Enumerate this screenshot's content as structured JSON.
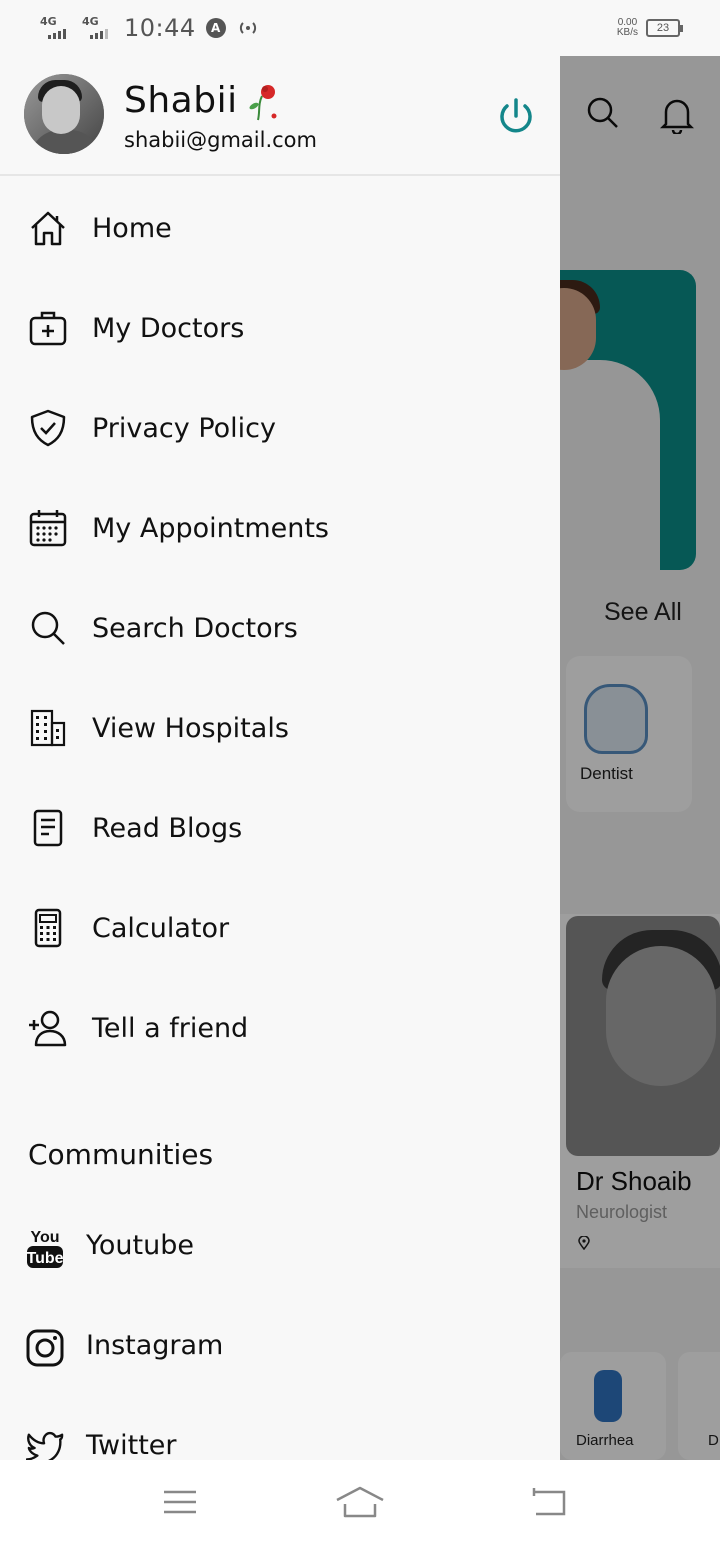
{
  "status_bar": {
    "network1": "4G",
    "network2": "4G",
    "time": "10:44",
    "app_icon": "A",
    "speed_value": "0.00",
    "speed_unit": "KB/s",
    "battery": "23"
  },
  "drawer": {
    "user_name": "Shabii",
    "user_email": "shabii@gmail.com",
    "accent_color": "#13868a",
    "menu": [
      {
        "label": "Home",
        "icon": "home-icon"
      },
      {
        "label": "My Doctors",
        "icon": "medical-bag-icon"
      },
      {
        "label": "Privacy Policy",
        "icon": "shield-check-icon"
      },
      {
        "label": "My Appointments",
        "icon": "calendar-icon"
      },
      {
        "label": "Search Doctors",
        "icon": "search-icon"
      },
      {
        "label": "View Hospitals",
        "icon": "building-icon"
      },
      {
        "label": "Read Blogs",
        "icon": "document-icon"
      },
      {
        "label": "Calculator",
        "icon": "calculator-icon"
      },
      {
        "label": "Tell a friend",
        "icon": "add-user-icon"
      }
    ],
    "communities_title": "Communities",
    "communities": [
      {
        "label": "Youtube",
        "icon": "youtube-icon",
        "icon_text_top": "You",
        "icon_text_bottom": "Tube"
      },
      {
        "label": "Instagram",
        "icon": "instagram-icon"
      },
      {
        "label": "Twitter",
        "icon": "twitter-icon"
      }
    ]
  },
  "background": {
    "see_all": "See All",
    "category": "Dentist",
    "doctor_name": "Dr Shoaib",
    "doctor_specialty": "Neurologist",
    "symptom1": "Diarrhea",
    "symptom2": "D"
  },
  "nav": {
    "menu_icon": "menu-lines-icon",
    "home_icon": "home-outline-icon",
    "back_icon": "back-icon"
  }
}
